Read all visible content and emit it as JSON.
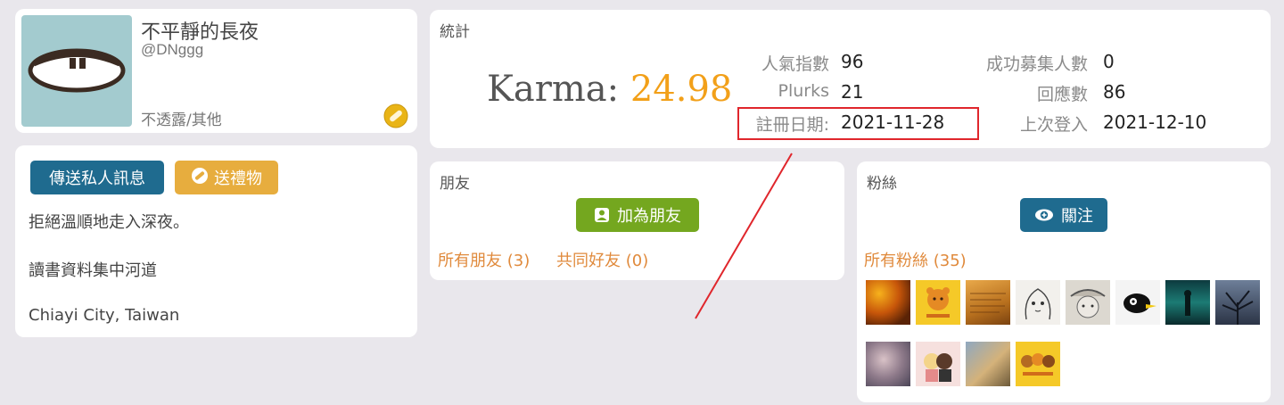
{
  "profile": {
    "display_name": "不平靜的長夜",
    "nick_name": "@DNggg",
    "gender_location": "不透露/其他"
  },
  "about": {
    "send_pm_label": "傳送私人訊息",
    "send_gift_label": "送禮物",
    "lines": [
      "拒絕溫順地走入深夜。",
      "讀書資料集中河道",
      "Chiayi City, Taiwan"
    ]
  },
  "stats": {
    "title": "統計",
    "karma_label": "Karma:",
    "karma_value": "24.98",
    "popularity_label": "人氣指數",
    "popularity_value": "96",
    "plurks_label": "Plurks",
    "plurks_value": "21",
    "register_label": "註冊日期:",
    "register_value": "2021-11-28",
    "recruit_label": "成功募集人數",
    "recruit_value": "0",
    "responses_label": "回應數",
    "responses_value": "86",
    "last_login_label": "上次登入",
    "last_login_value": "2021-12-10"
  },
  "friends": {
    "title": "朋友",
    "add_label": "加為朋友",
    "all_friends": "所有朋友 (3)",
    "mutual_friends": "共同好友 (0)"
  },
  "fans": {
    "title": "粉絲",
    "follow_label": "關注",
    "all_fans": "所有粉絲 (35)",
    "thumbnails": [
      "orange-flowers",
      "yellow-bear",
      "book-pages",
      "manga-girl",
      "sketch-face",
      "cartoon-bird",
      "teal-figure",
      "bare-tree",
      "pink-blossoms",
      "cartoon-couple",
      "bird-on-branch",
      "yellow-bears-group"
    ]
  },
  "colors": {
    "accent_orange": "#f2a019",
    "link_orange": "#e08a3c",
    "primary_blue": "#1f6b8f",
    "gift_yellow": "#e7ad3e",
    "add_green": "#74a71f",
    "highlight_red": "#e0262c"
  }
}
